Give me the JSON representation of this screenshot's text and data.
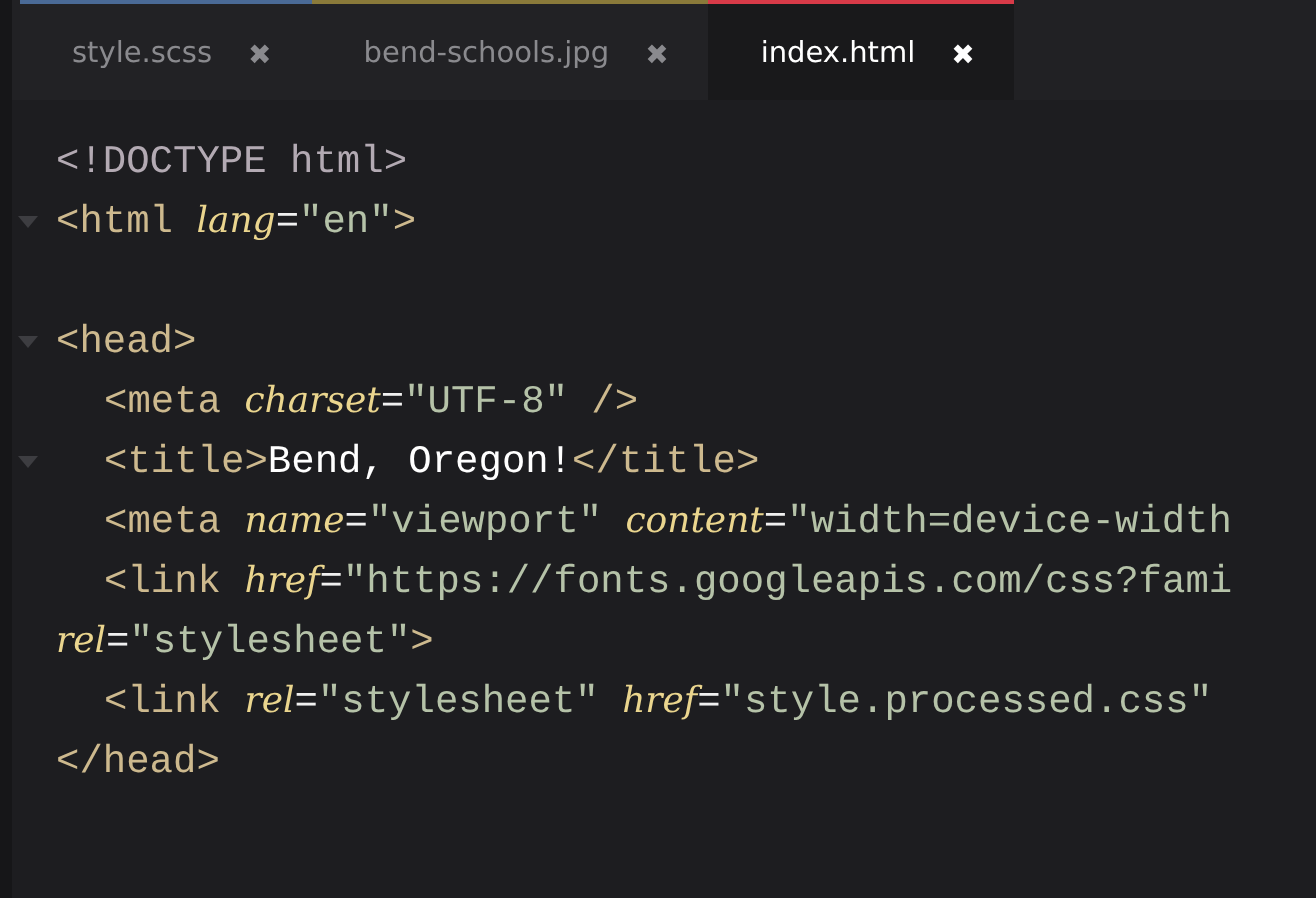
{
  "tabs": [
    {
      "label": "style.scss",
      "close": "✖",
      "selected": false,
      "color": "#4a6a96"
    },
    {
      "label": "bend-schools.jpg",
      "close": "✖",
      "selected": false,
      "color": "#8a7a3a"
    },
    {
      "label": "index.html",
      "close": "✖",
      "selected": true,
      "color": "#d83a48"
    }
  ],
  "code_lines": [
    {
      "foldable": false,
      "indented": false,
      "tokens": [
        {
          "kind": "doctype",
          "text": "<!DOCTYPE html>"
        }
      ]
    },
    {
      "foldable": true,
      "indented": false,
      "tokens": [
        {
          "kind": "tag",
          "text": "<html "
        },
        {
          "kind": "attr",
          "text": "lang"
        },
        {
          "kind": "punct",
          "text": "="
        },
        {
          "kind": "string",
          "text": "\"en\""
        },
        {
          "kind": "tag",
          "text": ">"
        }
      ]
    },
    {
      "foldable": true,
      "indented": false,
      "blank_before": true,
      "tokens": [
        {
          "kind": "tag",
          "text": "<head>"
        }
      ]
    },
    {
      "foldable": false,
      "indented": true,
      "tokens": [
        {
          "kind": "tag",
          "text": "<meta "
        },
        {
          "kind": "attr",
          "text": "charset"
        },
        {
          "kind": "punct",
          "text": "="
        },
        {
          "kind": "string",
          "text": "\"UTF-8\""
        },
        {
          "kind": "tag",
          "text": " />"
        }
      ]
    },
    {
      "foldable": true,
      "indented": true,
      "tokens": [
        {
          "kind": "tag",
          "text": "<title>"
        },
        {
          "kind": "text",
          "text": "Bend, Oregon!"
        },
        {
          "kind": "tag",
          "text": "</title>"
        }
      ]
    },
    {
      "foldable": false,
      "indented": true,
      "tokens": [
        {
          "kind": "tag",
          "text": "<meta "
        },
        {
          "kind": "attr",
          "text": "name"
        },
        {
          "kind": "punct",
          "text": "="
        },
        {
          "kind": "string",
          "text": "\"viewport\""
        },
        {
          "kind": "attr",
          "text": "content",
          "space_before": true
        },
        {
          "kind": "punct",
          "text": "="
        },
        {
          "kind": "string",
          "text": "\"width=device-width"
        }
      ]
    },
    {
      "foldable": false,
      "indented": true,
      "tokens": [
        {
          "kind": "tag",
          "text": "<link "
        },
        {
          "kind": "attr",
          "text": "href"
        },
        {
          "kind": "punct",
          "text": "="
        },
        {
          "kind": "string",
          "text": "\"https://fonts.googleapis.com/css?fami"
        }
      ]
    },
    {
      "foldable": false,
      "indented": false,
      "tokens": [
        {
          "kind": "attr",
          "text": "rel"
        },
        {
          "kind": "punct",
          "text": "="
        },
        {
          "kind": "string",
          "text": "\"stylesheet\""
        },
        {
          "kind": "tag",
          "text": ">"
        }
      ]
    },
    {
      "foldable": false,
      "indented": true,
      "tokens": [
        {
          "kind": "tag",
          "text": "<link "
        },
        {
          "kind": "attr",
          "text": "rel"
        },
        {
          "kind": "punct",
          "text": "="
        },
        {
          "kind": "string",
          "text": "\"stylesheet\""
        },
        {
          "kind": "attr",
          "text": "href",
          "space_before": true
        },
        {
          "kind": "punct",
          "text": "="
        },
        {
          "kind": "string",
          "text": "\"style.processed.css\""
        }
      ]
    },
    {
      "foldable": false,
      "indented": false,
      "tokens": [
        {
          "kind": "tag",
          "text": "</head>"
        }
      ]
    }
  ]
}
